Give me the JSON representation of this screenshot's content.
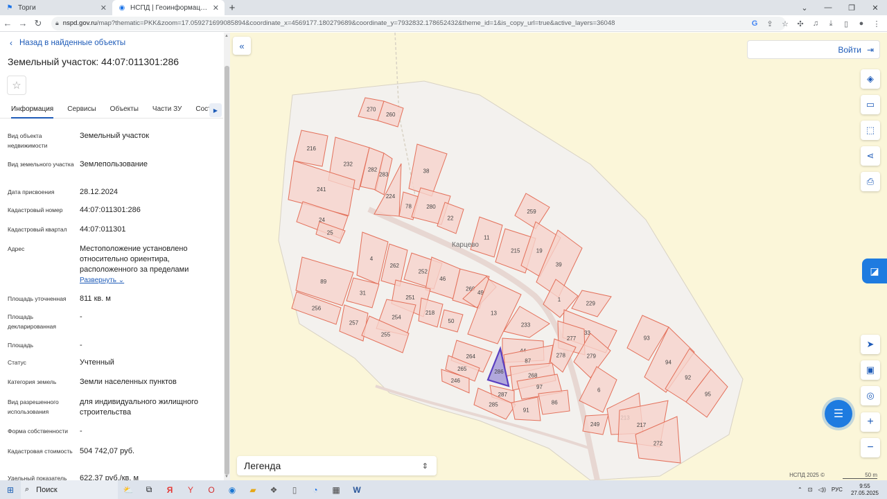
{
  "browser": {
    "tabs": [
      {
        "label": "Торги",
        "icon": "flag-icon"
      },
      {
        "label": "НСПД | Геоинформационный п",
        "icon": "globe-icon"
      }
    ],
    "url_domain": "nspd.gov.ru",
    "url_path": "/map?thematic=PKK&zoom=17.059271699085894&coordinate_x=4569177.180279689&coordinate_y=7932832.178652432&theme_id=1&is_copy_url=true&active_layers=36048"
  },
  "panel": {
    "back_label": "Назад в найденные объекты",
    "title": "Земельный участок: 44:07:011301:286",
    "tabs": [
      "Информация",
      "Сервисы",
      "Объекты",
      "Части ЗУ",
      "Соста"
    ],
    "properties": [
      {
        "label": "Вид объекта недвижимости",
        "value": "Земельный участок"
      },
      {
        "label": "Вид земельного участка",
        "value": "Землепользование"
      },
      {
        "label": "Дата присвоения",
        "value": "28.12.2024"
      },
      {
        "label": "Кадастровый номер",
        "value": "44:07:011301:286"
      },
      {
        "label": "Кадастровый квартал",
        "value": "44:07:011301"
      },
      {
        "label": "Адрес",
        "value": "Местоположение установлено относительно ориентира, расположенного за пределами"
      },
      {
        "label": "Площадь уточненная",
        "value": "811 кв. м"
      },
      {
        "label": "Площадь декларированная",
        "value": "-"
      },
      {
        "label": "Площадь",
        "value": "-"
      },
      {
        "label": "Статус",
        "value": "Учтенный"
      },
      {
        "label": "Категория земель",
        "value": "Земли населенных пунктов"
      },
      {
        "label": "Вид разрешенного использования",
        "value": "для индивидуального жилищного строительства"
      },
      {
        "label": "Форма собственности",
        "value": "-"
      },
      {
        "label": "Кадастровая стоимость",
        "value": "504 742,07 руб."
      },
      {
        "label": "Удельный показатель",
        "value": "622,37 руб./кв. м"
      }
    ],
    "expand_label": "Развернуть"
  },
  "map": {
    "login_label": "Войти",
    "village_label": "Карцево",
    "legend_label": "Легенда",
    "copyright": "НСПД 2025 ©",
    "scale": "50 m",
    "selected_parcel": "286",
    "colors": {
      "parcel_fill": "#f6d3cc",
      "parcel_stroke": "#e3705a",
      "selected_stroke": "#5a3fc0",
      "background": "#fbf6d9",
      "settlement": "#f3f1ee"
    },
    "parcels": [
      "270",
      "260",
      "216",
      "232",
      "282",
      "283",
      "38",
      "224",
      "241",
      "78",
      "280",
      "24",
      "22",
      "259",
      "25",
      "11",
      "215",
      "19",
      "4",
      "262",
      "252",
      "39",
      "89",
      "46",
      "269",
      "251",
      "256",
      "31",
      "49",
      "218",
      "1",
      "229",
      "50",
      "257",
      "254",
      "13",
      "233",
      "33",
      "255",
      "277",
      "44",
      "264",
      "87",
      "278",
      "279",
      "265",
      "286",
      "268",
      "246",
      "287",
      "97",
      "6",
      "285",
      "86",
      "91",
      "249",
      "93",
      "94",
      "92",
      "95",
      "213",
      "217",
      "272"
    ]
  },
  "taskbar": {
    "search_label": "Поиск",
    "lang": "РУС",
    "time": "9:55",
    "date": "27.05.2025"
  }
}
